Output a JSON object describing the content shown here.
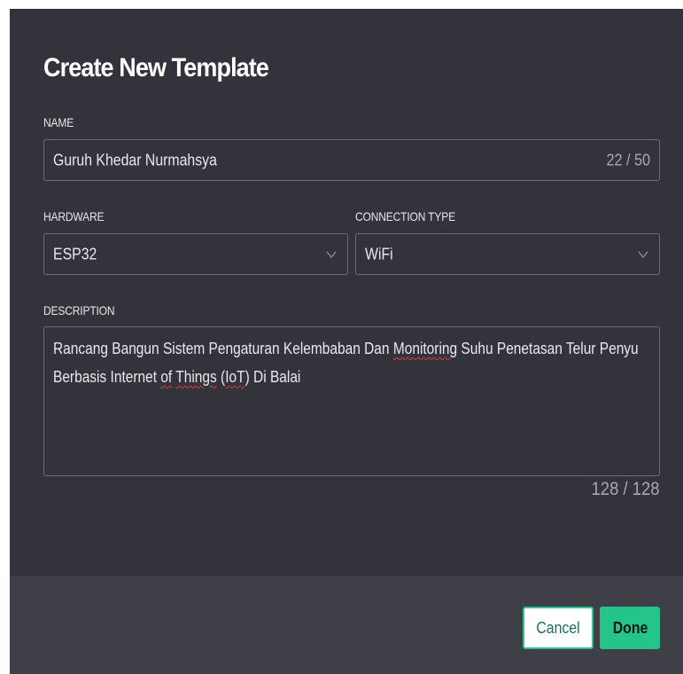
{
  "dialog": {
    "title": "Create New Template"
  },
  "name_field": {
    "label": "NAME",
    "value": "Guruh Khedar Nurmahsya",
    "counter": "22 / 50"
  },
  "hardware": {
    "label": "HARDWARE",
    "selected": "ESP32"
  },
  "connection_type": {
    "label": "CONNECTION TYPE",
    "selected": "WiFi"
  },
  "description": {
    "label": "DESCRIPTION",
    "segments": {
      "a": "Rancang Bangun Sistem Pengaturan Kelembaban Dan ",
      "b": "Monitoring",
      "c": " Suhu Penetasan Telur Penyu Berbasis Internet ",
      "d": "of",
      "e": " ",
      "f": "Things",
      "g": " (",
      "h": "IoT",
      "i": ") Di Balai"
    },
    "counter": "128 / 128"
  },
  "footer": {
    "cancel_label": "Cancel",
    "done_label": "Done"
  },
  "colors": {
    "dialog_bg": "#33343b",
    "footer_bg": "#3e3f47",
    "accent": "#24c48a",
    "spellcheck": "#e03b3b"
  },
  "icons": {
    "select_arrow": "chevron-down-icon"
  }
}
